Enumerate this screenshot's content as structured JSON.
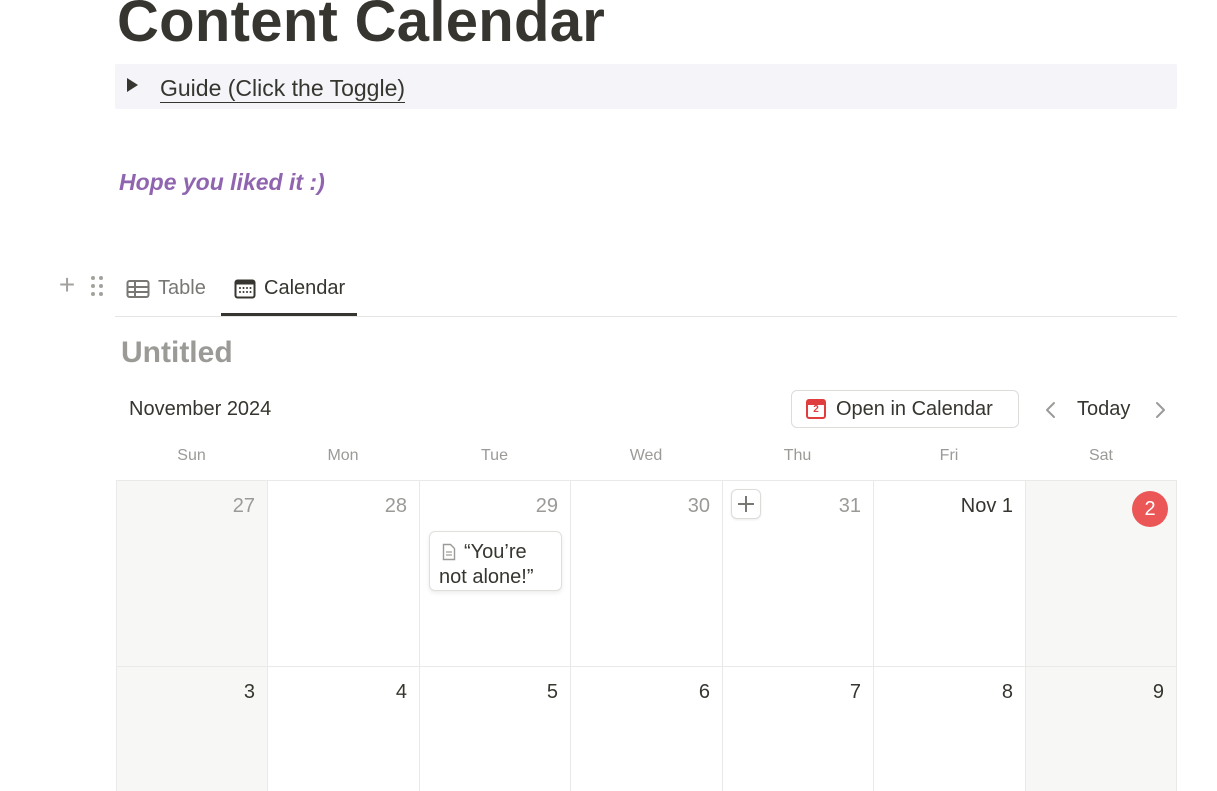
{
  "page": {
    "title": "Content Calendar",
    "toggle_label": "Guide (Click the Toggle)",
    "note": "Hope you liked it :)",
    "note_color": "#9065b0"
  },
  "views": {
    "tabs": [
      {
        "label": "Table",
        "icon": "table-icon",
        "active": false
      },
      {
        "label": "Calendar",
        "icon": "calendar-icon",
        "active": true
      }
    ]
  },
  "database": {
    "title": "Untitled"
  },
  "calendar": {
    "month_label": "November 2024",
    "open_button_label": "Open in Calendar",
    "open_button_icon_day": "2",
    "today_label": "Today",
    "weekdays": [
      "Sun",
      "Mon",
      "Tue",
      "Wed",
      "Thu",
      "Fri",
      "Sat"
    ],
    "today_color": "#eb5757",
    "weeks": [
      [
        {
          "label": "27",
          "current": false
        },
        {
          "label": "28",
          "current": false
        },
        {
          "label": "29",
          "current": false
        },
        {
          "label": "30",
          "current": false
        },
        {
          "label": "31",
          "current": false
        },
        {
          "label": "Nov 1",
          "current": true
        },
        {
          "label": "2",
          "current": true,
          "today": true
        }
      ],
      [
        {
          "label": "3",
          "current": true
        },
        {
          "label": "4",
          "current": true
        },
        {
          "label": "5",
          "current": true
        },
        {
          "label": "6",
          "current": true
        },
        {
          "label": "7",
          "current": true
        },
        {
          "label": "8",
          "current": true
        },
        {
          "label": "9",
          "current": true
        }
      ]
    ],
    "events": [
      {
        "title": "“You’re not alone!”",
        "icon": "page-icon",
        "week": 0,
        "day": 2
      }
    ]
  }
}
